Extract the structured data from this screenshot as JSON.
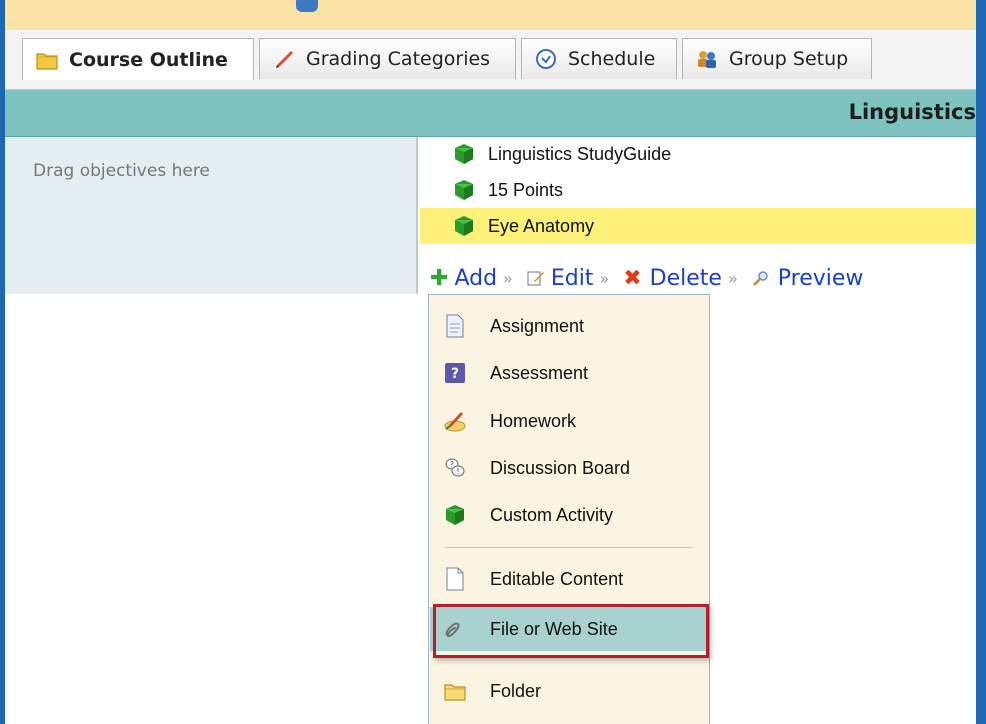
{
  "tabs": [
    {
      "label": "Course Outline",
      "icon": "folder-icon",
      "active": true
    },
    {
      "label": "Grading Categories",
      "icon": "pencil-icon",
      "active": false
    },
    {
      "label": "Schedule",
      "icon": "clock-icon",
      "active": false
    },
    {
      "label": "Group Setup",
      "icon": "group-icon",
      "active": false
    }
  ],
  "header": {
    "title": "Linguistics"
  },
  "left_panel": {
    "drag_text": "Drag objectives here"
  },
  "course_items": [
    {
      "label": "Linguistics StudyGuide",
      "icon": "green-cube-icon",
      "selected": false
    },
    {
      "label": "15 Points",
      "icon": "green-cube-icon",
      "selected": false
    },
    {
      "label": "Eye Anatomy",
      "icon": "green-cube-icon",
      "selected": true
    }
  ],
  "actions": {
    "add_label": "Add",
    "edit_label": "Edit",
    "delete_label": "Delete",
    "preview_label": "Preview"
  },
  "add_menu": {
    "items": [
      {
        "label": "Assignment",
        "icon": "assignment-icon"
      },
      {
        "label": "Assessment",
        "icon": "assessment-icon"
      },
      {
        "label": "Homework",
        "icon": "homework-icon"
      },
      {
        "label": "Discussion Board",
        "icon": "discussion-icon"
      },
      {
        "label": "Custom Activity",
        "icon": "green-cube-icon"
      },
      {
        "label": "Editable Content",
        "icon": "document-icon"
      },
      {
        "label": "File or Web Site",
        "icon": "paperclip-icon",
        "highlighted": true
      },
      {
        "label": "Folder",
        "icon": "folder-icon"
      }
    ]
  },
  "colors": {
    "header_band": "#7ec3bf",
    "selected_row": "#fdf17a",
    "menu_bg": "#fbf4e3",
    "menu_highlight": "#a9d2cf",
    "callout_border": "#b3202c",
    "action_link": "#1a3fcc"
  }
}
